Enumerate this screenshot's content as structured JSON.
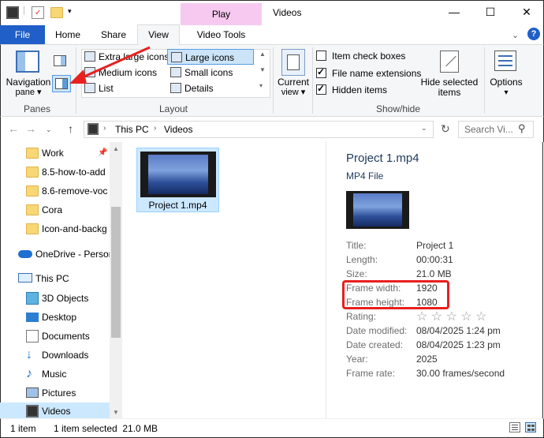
{
  "window": {
    "title": "Videos",
    "context_tab": "Play",
    "controls": {
      "minimize": "—",
      "maximize": "☐",
      "close": "✕"
    }
  },
  "ribbon_tabs": {
    "file": "File",
    "home": "Home",
    "share": "Share",
    "view": "View",
    "video_tools": "Video Tools"
  },
  "ribbon": {
    "panes": {
      "navigation_pane_line1": "Navigation",
      "navigation_pane_line2": "pane ▾",
      "group_label": "Panes"
    },
    "layout": {
      "items": [
        "Extra large icons",
        "Large icons",
        "Medium icons",
        "Small icons",
        "List",
        "Details"
      ],
      "selected": "Large icons",
      "group_label": "Layout"
    },
    "current_view": {
      "line1": "Current",
      "line2": "view ▾"
    },
    "show_hide": {
      "item_check_boxes": {
        "label": "Item check boxes",
        "checked": false
      },
      "file_name_extensions": {
        "label": "File name extensions",
        "checked": true
      },
      "hidden_items": {
        "label": "Hidden items",
        "checked": true
      },
      "hide_selected_line1": "Hide selected",
      "hide_selected_line2": "items",
      "group_label": "Show/hide"
    },
    "options": {
      "line1": "Options",
      "line2": "▾"
    }
  },
  "address": {
    "path": [
      "This PC",
      "Videos"
    ],
    "separator": "›",
    "search_placeholder": "Search Vi..."
  },
  "nav_pane": {
    "quick_access": [
      "Work",
      "8.5-how-to-add",
      "8.6-remove-voc",
      "Cora",
      "Icon-and-backg"
    ],
    "onedrive": "OneDrive - Person",
    "this_pc": "This PC",
    "this_pc_items": [
      "3D Objects",
      "Desktop",
      "Documents",
      "Downloads",
      "Music",
      "Pictures",
      "Videos"
    ]
  },
  "content": {
    "file_name": "Project 1.mp4"
  },
  "details": {
    "title": "Project 1.mp4",
    "type": "MP4 File",
    "properties": [
      {
        "k": "Title:",
        "v": "Project 1"
      },
      {
        "k": "Length:",
        "v": "00:00:31"
      },
      {
        "k": "Size:",
        "v": "21.0 MB"
      },
      {
        "k": "Frame width:",
        "v": "1920"
      },
      {
        "k": "Frame height:",
        "v": "1080"
      },
      {
        "k": "Rating:",
        "v": "☆ ☆ ☆ ☆ ☆"
      },
      {
        "k": "Date modified:",
        "v": "08/04/2025 1:24 pm"
      },
      {
        "k": "Date created:",
        "v": "08/04/2025 1:23 pm"
      },
      {
        "k": "Year:",
        "v": "2025"
      },
      {
        "k": "Frame rate:",
        "v": "30.00 frames/second"
      }
    ]
  },
  "status": {
    "count": "1 item",
    "selection": "1 item selected  21.0 MB"
  },
  "annotation_color": "#e8201f",
  "accent": "#1f5fc7"
}
